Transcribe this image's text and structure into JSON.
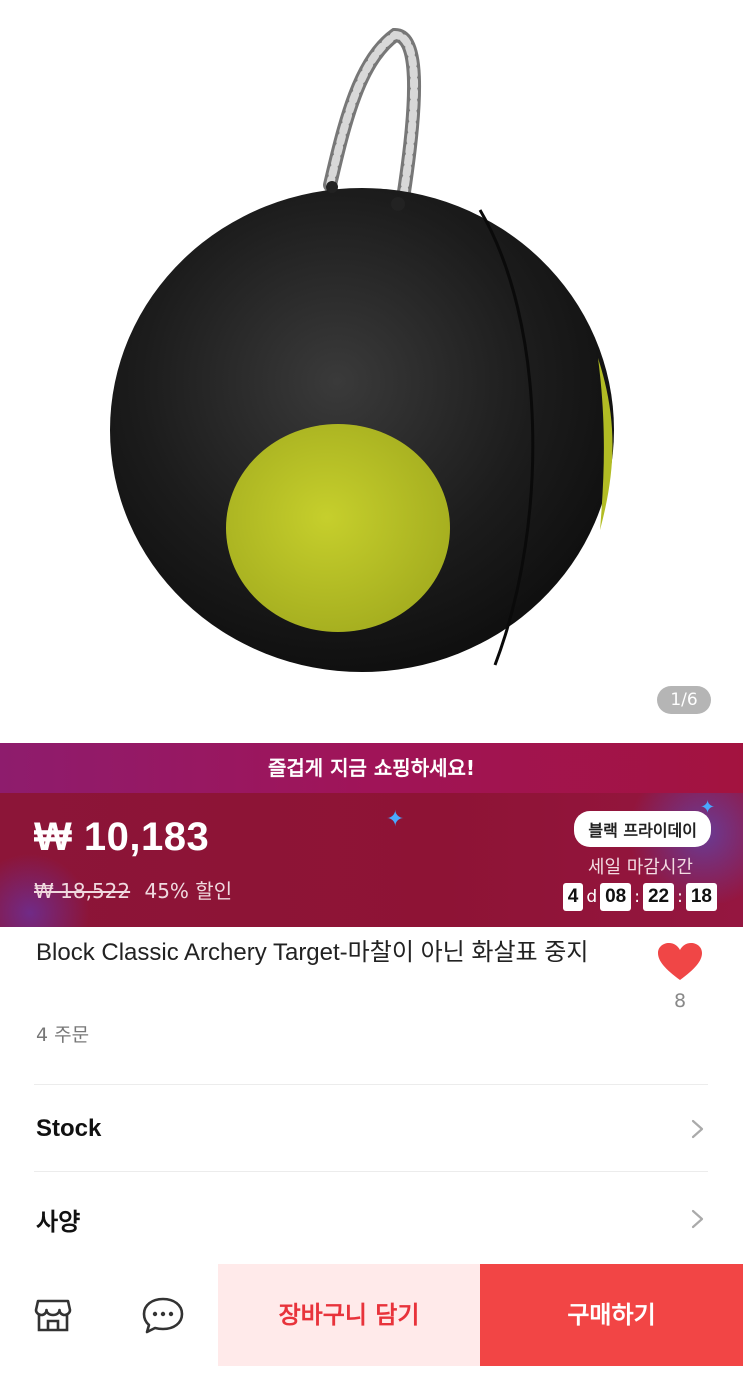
{
  "gallery": {
    "indicator": "1/6"
  },
  "promo": {
    "banner_text": "즐겁게 지금 쇼핑하세요!"
  },
  "price": {
    "current": "₩ 10,183",
    "original": "₩ 18,522",
    "discount": "45% 할인"
  },
  "sale": {
    "badge": "블랙 프라이데이",
    "deadline_label": "세일 마감시간",
    "countdown": {
      "days": "4",
      "day_unit": "d",
      "hours": "08",
      "minutes": "22",
      "seconds": "18",
      "sep": ":"
    }
  },
  "product": {
    "title": "Block Classic Archery Target-마찰이 아닌 화살표 중지",
    "orders": "4 주문",
    "favorites": "8"
  },
  "options": [
    {
      "label": "Stock"
    },
    {
      "label": "사양"
    }
  ],
  "bottom_bar": {
    "store_icon": "store-icon",
    "chat_icon": "chat-icon",
    "cart_label": "장바구니 담기",
    "buy_label": "구매하기"
  },
  "colors": {
    "accent": "#f24545",
    "banner": "#a01458",
    "price_bg": "#8e1335",
    "heart": "#f04646"
  }
}
